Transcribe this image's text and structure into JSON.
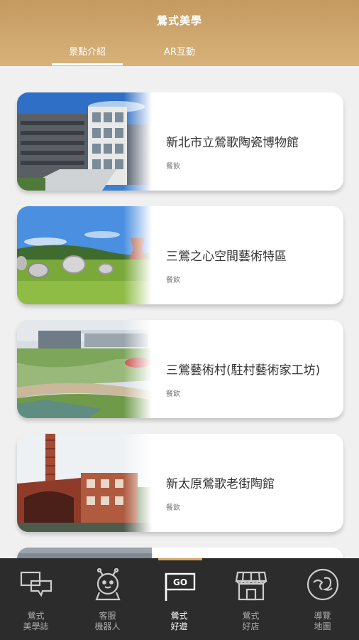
{
  "header": {
    "title": "鶯式美學",
    "tabs": [
      {
        "label": "景點介紹",
        "active": true
      },
      {
        "label": "AR互動",
        "active": false
      }
    ],
    "gradient": [
      "#c49a60",
      "#d8b27a"
    ]
  },
  "cards": [
    {
      "title": "新北市立鶯歌陶瓷博物館",
      "subtitle": "餐飲",
      "image": "museum-building-photo"
    },
    {
      "title": "三鶯之心空間藝術特區",
      "subtitle": "餐飲",
      "image": "sculpture-park-photo"
    },
    {
      "title": "三鶯藝術村(駐村藝術家工坊)",
      "subtitle": "餐飲",
      "image": "art-village-photo"
    },
    {
      "title": "新太原鶯歌老街陶館",
      "subtitle": "餐飲",
      "image": "brick-kiln-chimney-photo"
    }
  ],
  "bottom_nav": [
    {
      "label_1": "鶯式",
      "label_2": "美學誌",
      "icon": "chat-bubbles-icon",
      "active": false
    },
    {
      "label_1": "客服",
      "label_2": "機器人",
      "icon": "robot-icon",
      "active": false
    },
    {
      "label_1": "鶯式",
      "label_2": "好遊",
      "icon": "go-flag-icon",
      "active": true
    },
    {
      "label_1": "鶯式",
      "label_2": "好店",
      "icon": "store-icon",
      "active": false
    },
    {
      "label_1": "導覽",
      "label_2": "地圖",
      "icon": "map-logo-icon",
      "active": false
    }
  ],
  "colors": {
    "accent": "#d8a860",
    "nav_bg": "#2c2c2c"
  }
}
